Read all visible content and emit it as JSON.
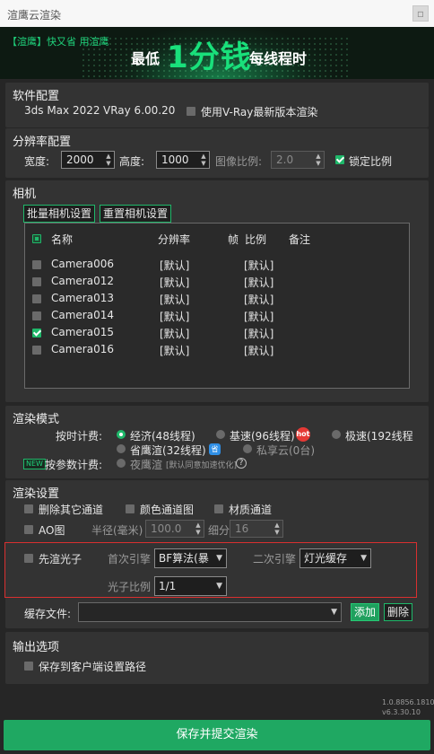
{
  "window": {
    "title": "渲鹰云渲染",
    "close": "▫"
  },
  "banner": {
    "left": "【渲鹰】快又省 用渲鹰",
    "p1": "最低",
    "p2": "1分钱",
    "p3": "每线程时"
  },
  "software": {
    "heading": "软件配置",
    "max": "3ds Max 2022",
    "vray": "VRay 6.00.20",
    "latest_label": "使用V-Ray最新版本渲染",
    "latest_checked": false
  },
  "resolution": {
    "heading": "分辨率配置",
    "width_label": "宽度:",
    "width": "2000",
    "height_label": "高度:",
    "height": "1000",
    "ratio_label": "图像比例:",
    "ratio": "2.0",
    "lock_label": "锁定比例",
    "lock_checked": true
  },
  "camera": {
    "heading": "相机",
    "batch_btn": "批量相机设置",
    "reset_btn": "重置相机设置",
    "columns": {
      "name": "名称",
      "res": "分辨率",
      "frame": "帧",
      "ratio": "比例",
      "note": "备注"
    },
    "rows": [
      {
        "name": "Camera006",
        "res": "[默认]",
        "ratio": "[默认]",
        "checked": false
      },
      {
        "name": "Camera012",
        "res": "[默认]",
        "ratio": "[默认]",
        "checked": false
      },
      {
        "name": "Camera013",
        "res": "[默认]",
        "ratio": "[默认]",
        "checked": false
      },
      {
        "name": "Camera014",
        "res": "[默认]",
        "ratio": "[默认]",
        "checked": false
      },
      {
        "name": "Camera015",
        "res": "[默认]",
        "ratio": "[默认]",
        "checked": true
      },
      {
        "name": "Camera016",
        "res": "[默认]",
        "ratio": "[默认]",
        "checked": false
      }
    ]
  },
  "render_mode": {
    "heading": "渲染模式",
    "time_label": "按时计费:",
    "opt_economy": "经济(48线程)",
    "opt_basic": "基速(96线程)",
    "opt_fast": "极速(192线程",
    "opt_saver": "省鹰渲(32线程)",
    "opt_private": "私享云(0台)",
    "param_label": "按参数计费:",
    "opt_night": "夜鹰渲",
    "night_note": "[默认同意加速优化]",
    "hot": "hot",
    "new": "NEW",
    "vip": "省",
    "help": "?",
    "selected": "经济(48线程)"
  },
  "render_settings": {
    "heading": "渲染设置",
    "del_channels": "删除其它通道",
    "color_channel": "颜色通道图",
    "material_channel": "材质通道",
    "ao": "AO图",
    "radius_label": "半径(毫米)",
    "radius": "100.0",
    "subdiv_label": "细分",
    "subdiv": "16",
    "prerender": "先渲光子",
    "primary_label": "首次引擎",
    "primary": "BF算法(暴",
    "secondary_label": "二次引擎",
    "secondary": "灯光缓存",
    "photon_ratio_label": "光子比例",
    "photon_ratio": "1/1",
    "cache_label": "缓存文件:",
    "cache_value": "",
    "add_btn": "添加",
    "del_btn": "删除"
  },
  "output": {
    "heading": "输出选项",
    "save_client": "保存到客户端设置路径"
  },
  "version": {
    "v1": "1.0.8856.18100",
    "v2": "v6.3.30.10"
  },
  "submit_label": "保存并提交渲染",
  "colors": {
    "accent": "#1fb86a",
    "bg": "#262626",
    "panel": "#333333",
    "danger": "#d93030"
  }
}
